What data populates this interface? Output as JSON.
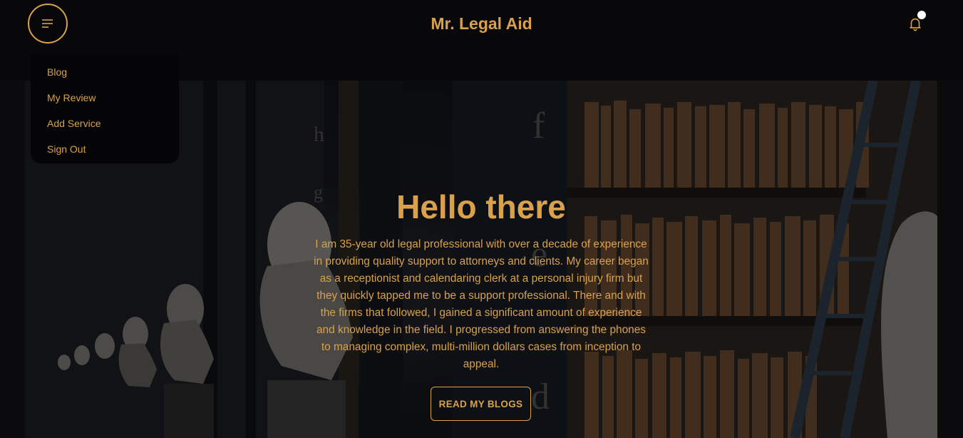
{
  "header": {
    "brand": "Mr. Legal Aid",
    "menu_icon": "hamburger-icon",
    "notification_icon": "bell-icon"
  },
  "dropdown": {
    "items": [
      {
        "label": "Blog"
      },
      {
        "label": "My Review"
      },
      {
        "label": "Add Service"
      },
      {
        "label": "Sign Out"
      }
    ]
  },
  "hero": {
    "title": "Hello there",
    "text": "I am 35-year old legal professional with over a decade of experience in providing quality support to attorneys and clients. My career began as a receptionist and calendaring clerk at a personal injury firm but they quickly tapped me to be a support professional. There and with the firms that followed, I gained a significant amount of experience and knowledge in the field. I progressed from answering the phones to managing complex, multi-million dollars cases from inception to appeal.",
    "button_label": "READ MY BLOGS",
    "background": "library-with-busts-and-bookshelves"
  },
  "colors": {
    "accent": "#d9a14b",
    "navbar": "#08080b",
    "dropdown": "#050507"
  }
}
